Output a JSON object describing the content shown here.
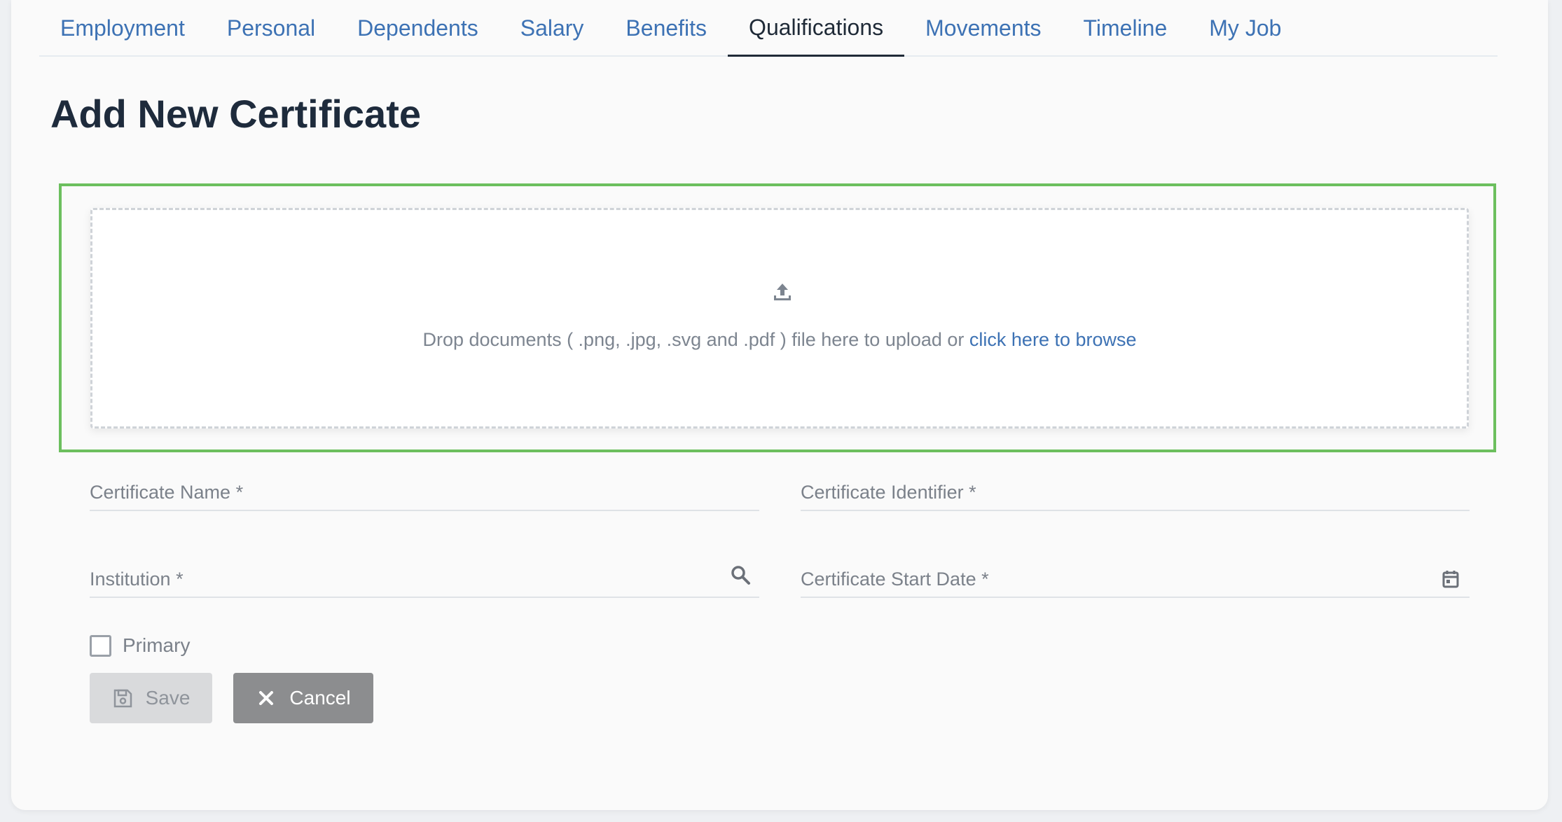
{
  "tabs": [
    {
      "label": "Employment"
    },
    {
      "label": "Personal"
    },
    {
      "label": "Dependents"
    },
    {
      "label": "Salary"
    },
    {
      "label": "Benefits"
    },
    {
      "label": "Qualifications",
      "active": true
    },
    {
      "label": "Movements"
    },
    {
      "label": "Timeline"
    },
    {
      "label": "My Job"
    }
  ],
  "page_title": "Add New Certificate",
  "dropzone": {
    "icon": "upload-icon",
    "text": "Drop documents ( .png, .jpg, .svg and .pdf ) file here to upload or ",
    "link": "click here to browse"
  },
  "form": {
    "certificate_name": {
      "label": "Certificate Name *",
      "value": ""
    },
    "certificate_identifier": {
      "label": "Certificate Identifier *",
      "value": ""
    },
    "institution": {
      "label": "Institution *",
      "value": "",
      "icon": "search-icon"
    },
    "start_date": {
      "label": "Certificate Start Date *",
      "value": "",
      "icon": "calendar-icon"
    },
    "primary": {
      "label": "Primary",
      "checked": false
    }
  },
  "buttons": {
    "save": {
      "label": "Save",
      "icon": "save-icon"
    },
    "cancel": {
      "label": "Cancel",
      "icon": "close-icon"
    }
  },
  "colors": {
    "link": "#3d72b4",
    "highlight": "#6cbf5e",
    "title": "#1e2b3c"
  }
}
